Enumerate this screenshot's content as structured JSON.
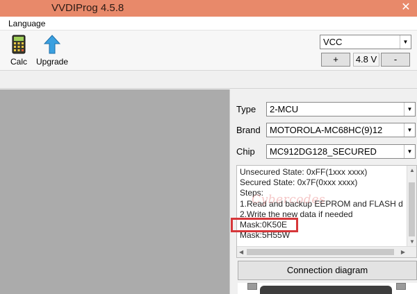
{
  "window": {
    "title": "VVDIProg 4.5.8"
  },
  "menu": {
    "items": [
      "Language"
    ]
  },
  "toolbar": {
    "calc_label": "Calc",
    "upgrade_label": "Upgrade"
  },
  "voltage": {
    "selected": "VCC",
    "plus_label": "+",
    "value": "4.8 V",
    "minus_label": "-"
  },
  "fields": {
    "type": {
      "label": "Type",
      "value": "2-MCU"
    },
    "brand": {
      "label": "Brand",
      "value": "MOTOROLA-MC68HC(9)12"
    },
    "chip": {
      "label": "Chip",
      "value": "MC912DG128_SECURED"
    }
  },
  "info": {
    "lines": [
      "Unsecured State:  0xFF(1xxx xxxx)",
      "Secured State:    0x7F(0xxx xxxx)",
      "Steps:",
      "1.Read and backup EEPROM and FLASH d",
      "2.Write the new data if needed",
      "Mask:0K50E",
      "Mask:5H55W"
    ],
    "watermark": "Cybercodes"
  },
  "connection_button": "Connection diagram",
  "colors": {
    "titlebar": "#e8896a",
    "highlight": "#d6373a",
    "workspace": "#ababab"
  }
}
